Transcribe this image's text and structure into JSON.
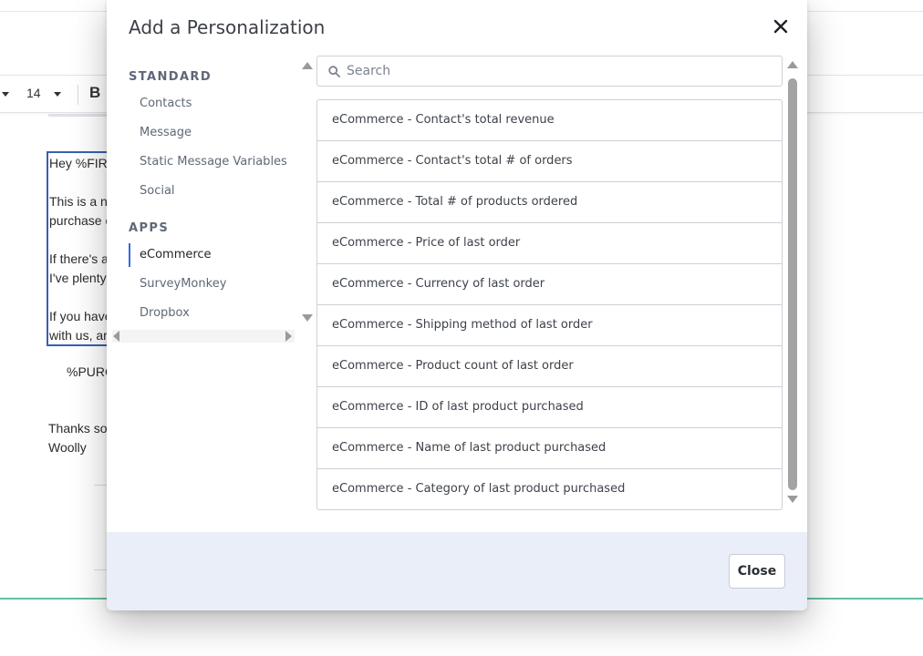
{
  "editor": {
    "font_size": "14",
    "bold_label": "B",
    "lines": [
      "Hey %FIR",
      "This is a n",
      "purchase o",
      "If there's a",
      "I've plenty",
      "If you have",
      "with us, ar",
      "%PURC",
      "Thanks so",
      "Woolly"
    ]
  },
  "modal": {
    "title": "Add a Personalization",
    "close_icon": "close-icon",
    "nav": {
      "standard_heading": "STANDARD",
      "standard_items": [
        "Contacts",
        "Message",
        "Static Message Variables",
        "Social"
      ],
      "apps_heading": "APPS",
      "apps_items": [
        "eCommerce",
        "SurveyMonkey",
        "Dropbox"
      ],
      "active_item": "eCommerce"
    },
    "search": {
      "placeholder": "Search",
      "icon": "search-icon"
    },
    "list_items": [
      "eCommerce - Contact's total revenue",
      "eCommerce - Contact's total # of orders",
      "eCommerce - Total # of products ordered",
      "eCommerce - Price of last order",
      "eCommerce - Currency of last order",
      "eCommerce - Shipping method of last order",
      "eCommerce - Product count of last order",
      "eCommerce - ID of last product purchased",
      "eCommerce - Name of last product purchased",
      "eCommerce - Category of last product purchased"
    ],
    "close_button_label": "Close"
  },
  "colors": {
    "accent": "#356ae6",
    "footer_bg": "#eaeef8",
    "editor_border": "#3a5fb4",
    "green_rule": "#63c0a0"
  }
}
